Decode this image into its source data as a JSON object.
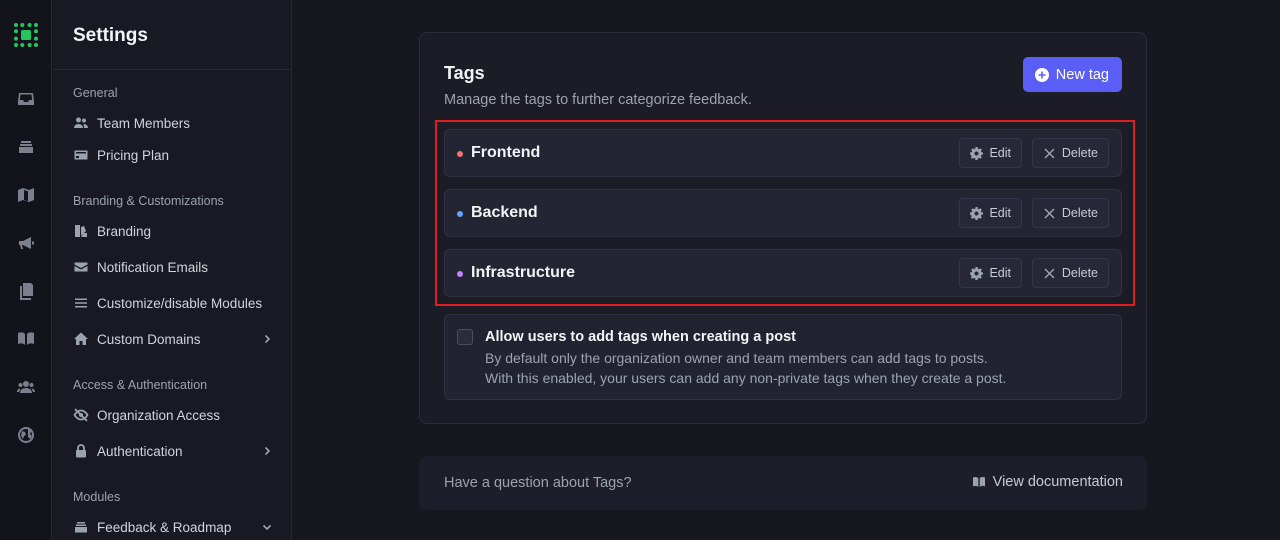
{
  "sidebar": {
    "title": "Settings",
    "sections": {
      "general": "General",
      "branding": "Branding & Customizations",
      "access": "Access & Authentication",
      "modules": "Modules"
    },
    "items": {
      "team_members": "Team Members",
      "pricing_plan": "Pricing Plan",
      "branding": "Branding",
      "notification_emails": "Notification Emails",
      "customize_modules": "Customize/disable Modules",
      "custom_domains": "Custom Domains",
      "organization_access": "Organization Access",
      "authentication": "Authentication",
      "feedback_roadmap": "Feedback & Roadmap"
    }
  },
  "tags_card": {
    "title": "Tags",
    "subtitle": "Manage the tags to further categorize feedback.",
    "new_tag_label": "New tag",
    "edit_label": "Edit",
    "delete_label": "Delete",
    "tags": [
      {
        "name": "Frontend",
        "color": "#f87171"
      },
      {
        "name": "Backend",
        "color": "#60a5fa"
      },
      {
        "name": "Infrastructure",
        "color": "#c084fc"
      }
    ],
    "allow_option": {
      "label": "Allow users to add tags when creating a post",
      "description_line1": "By default only the organization owner and team members can add tags to posts.",
      "description_line2": "With this enabled, your users can add any non-private tags when they create a post.",
      "checked": false
    }
  },
  "help": {
    "question": "Have a question about Tags?",
    "link_label": "View documentation"
  },
  "colors": {
    "accent": "#5b5ef4",
    "logo": "#22c55e",
    "highlight": "#e11d24"
  }
}
